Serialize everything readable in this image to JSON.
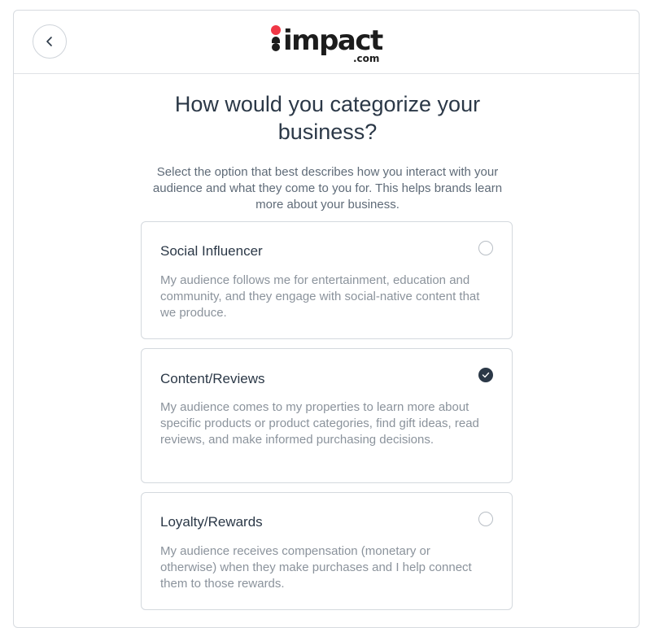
{
  "header": {
    "back_icon": "chevron-left-icon",
    "logo": {
      "word": "impact",
      "suffix": ".com",
      "dot_color": "#f03746"
    }
  },
  "main": {
    "title": "How would you categorize your business?",
    "subtitle": "Select the option that best describes how you interact with your audience and what they come to you for. This helps brands learn more about your business."
  },
  "options": [
    {
      "title": "Social Influencer",
      "description": "My audience follows me for entertainment, education and community, and they engage with social-native content that we produce.",
      "selected": false
    },
    {
      "title": "Content/Reviews",
      "description": "My audience comes to my properties to learn more about specific products or product categories, find gift ideas, read reviews, and make informed purchasing decisions.",
      "selected": true
    },
    {
      "title": "Loyalty/Rewards",
      "description": "My audience receives compensation (monetary or otherwise) when they make purchases and I help connect them to those rewards.",
      "selected": false
    }
  ],
  "colors": {
    "text_primary": "#2b3847",
    "text_secondary": "#8b939c",
    "border": "#d4d9de",
    "selected_radio": "#2b3847"
  }
}
